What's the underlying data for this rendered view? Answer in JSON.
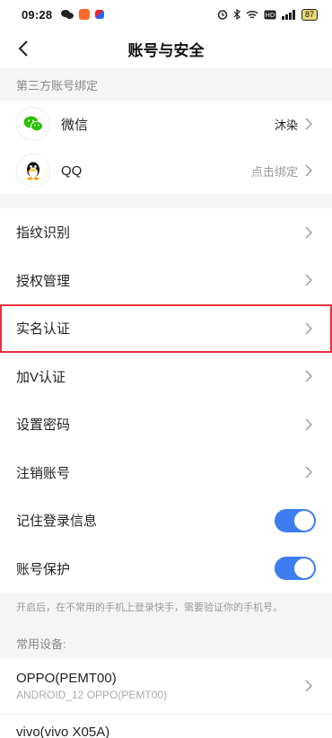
{
  "status": {
    "time": "09:28",
    "battery": "87"
  },
  "nav": {
    "title": "账号与安全"
  },
  "third_party": {
    "header": "第三方账号绑定",
    "items": [
      {
        "label": "微信",
        "value": "沐染"
      },
      {
        "label": "QQ",
        "value": "点击绑定"
      }
    ]
  },
  "menu": {
    "fingerprint": "指纹识别",
    "auth": "授权管理",
    "realname": "实名认证",
    "vverify": "加V认证",
    "password": "设置密码",
    "cancel": "注销账号",
    "remember": "记住登录信息",
    "protect": "账号保护"
  },
  "toggles": {
    "remember_on": true,
    "protect_on": true
  },
  "hint": "开启后，在不常用的手机上登录快手，需要验证你的手机号。",
  "devices": {
    "header": "常用设备:",
    "items": [
      {
        "name": "OPPO(PEMT00)",
        "sub": "ANDROID_12 OPPO(PEMT00)"
      },
      {
        "name": "vivo(vivo X05A)"
      }
    ]
  },
  "colors": {
    "accent": "#3d7df0",
    "highlight": "#e6323c",
    "wechat": "#2dc100"
  }
}
